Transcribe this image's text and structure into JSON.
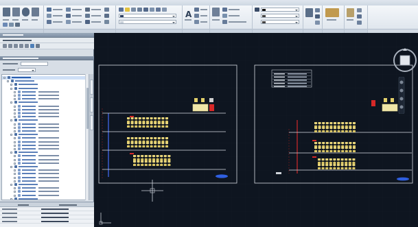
{
  "ribbon": {
    "groups": [
      {
        "label": ""
      },
      {
        "label": ""
      },
      {
        "label": ""
      },
      {
        "label": ""
      },
      {
        "label": ""
      },
      {
        "label": ""
      },
      {
        "label": ""
      },
      {
        "label": ""
      },
      {
        "label": ""
      },
      {
        "label": ""
      }
    ]
  },
  "left_panel": {
    "title": "",
    "subtitle": "",
    "section_title": "",
    "tree_items": [
      {
        "label": ""
      },
      {
        "label": ""
      },
      {
        "label": ""
      },
      {
        "label": ""
      },
      {
        "label": ""
      },
      {
        "label": ""
      },
      {
        "label": ""
      },
      {
        "label": ""
      }
    ],
    "properties": [
      {
        "key": "",
        "value": ""
      },
      {
        "key": "",
        "value": ""
      },
      {
        "key": "",
        "value": ""
      },
      {
        "key": "",
        "value": ""
      }
    ]
  },
  "drawing": {
    "viewcube_face": ""
  }
}
